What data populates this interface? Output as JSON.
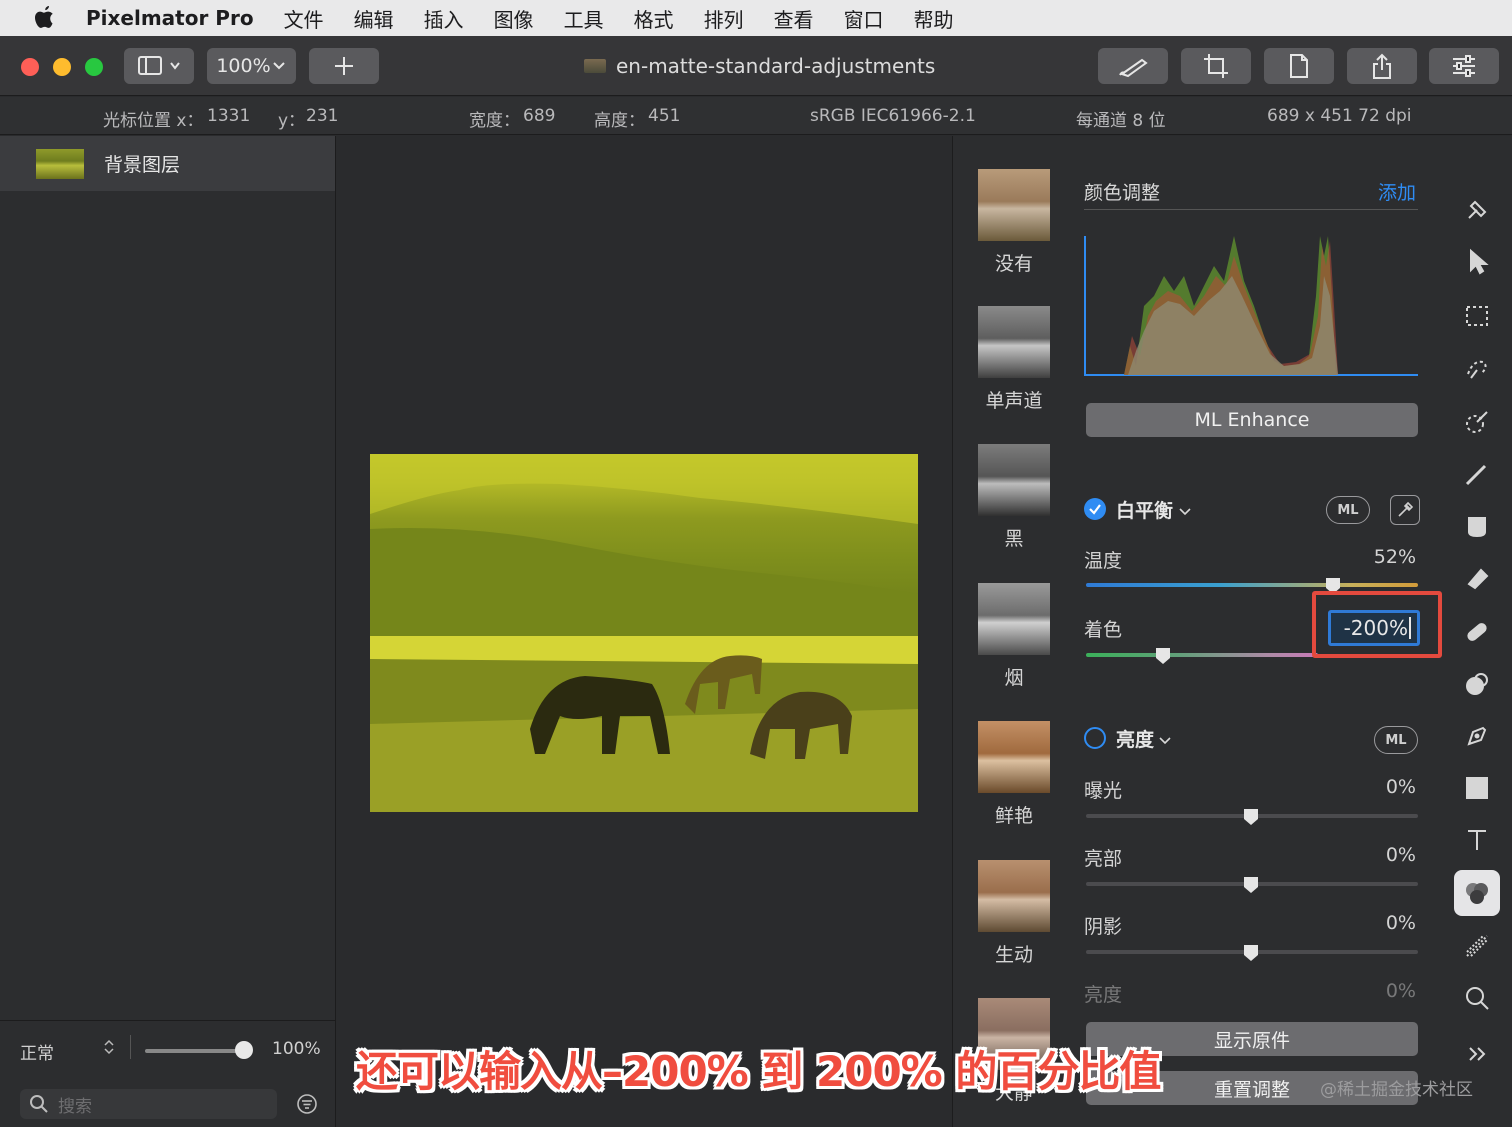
{
  "menubar": {
    "app": "Pixelmator Pro",
    "items": [
      "文件",
      "编辑",
      "插入",
      "图像",
      "工具",
      "格式",
      "排列",
      "查看",
      "窗口",
      "帮助"
    ]
  },
  "toolbar": {
    "zoom": "100%",
    "document_title": "en-matte-standard-adjustments"
  },
  "infobar": {
    "cursor_x_label": "光标位置 x：",
    "cursor_x": "1331",
    "cursor_y_label": "y：",
    "cursor_y": "231",
    "width_label": "宽度：",
    "width": "689",
    "height_label": "高度：",
    "height": "451",
    "color_profile": "sRGB IEC61966-2.1",
    "bit_depth": "每通道 8 位",
    "dimensions": "689 x 451 72 dpi"
  },
  "layers": {
    "items": [
      {
        "name": "背景图层"
      }
    ],
    "blend_mode": "正常",
    "opacity": "100%",
    "search_placeholder": "搜索"
  },
  "presets": [
    {
      "label": "没有"
    },
    {
      "label": "单声道"
    },
    {
      "label": "黑"
    },
    {
      "label": "烟"
    },
    {
      "label": "鲜艳"
    },
    {
      "label": "生动"
    },
    {
      "label": "大静"
    }
  ],
  "adjustments": {
    "title": "颜色调整",
    "add": "添加",
    "ml_enhance": "ML Enhance",
    "white_balance": {
      "name": "白平衡",
      "enabled": true,
      "ml": "ML",
      "temperature_label": "温度",
      "temperature_value": "52%",
      "tint_label": "着色",
      "tint_value": "-200%"
    },
    "brightness": {
      "name": "亮度",
      "enabled": false,
      "ml": "ML",
      "exposure_label": "曝光",
      "exposure_value": "0%",
      "highlights_label": "亮部",
      "highlights_value": "0%",
      "shadows_label": "阴影",
      "shadows_value": "0%",
      "brightness_label": "亮度",
      "brightness_value": "0%"
    },
    "show_original": "显示原件",
    "reset": "重置调整"
  },
  "caption": "还可以输入从–200% 到 200% 的百分比值",
  "watermark": "@稀土掘金技术社区",
  "colors": {
    "accent": "#2f8cf3",
    "highlight": "#e44a3e"
  }
}
